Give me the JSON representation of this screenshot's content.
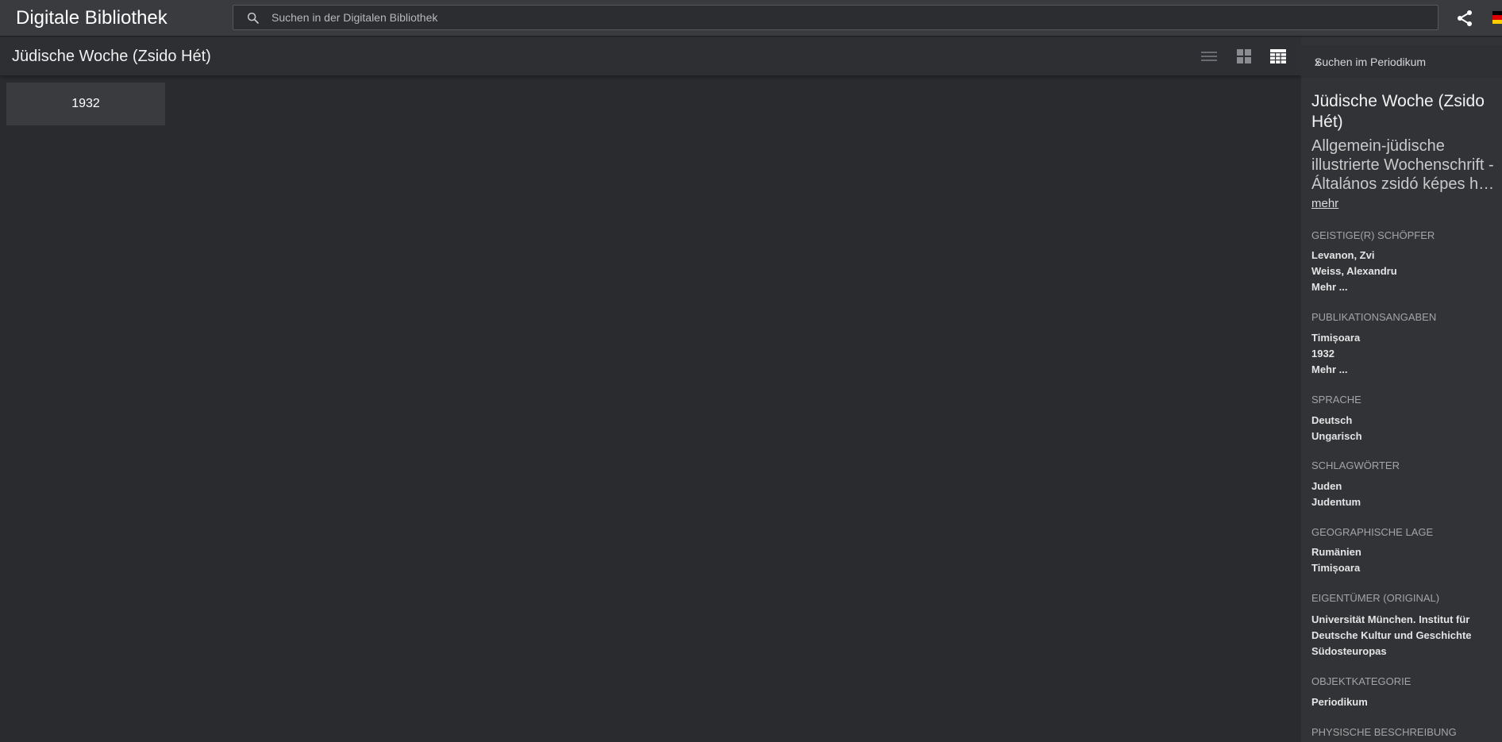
{
  "topbar": {
    "brand": "Digitale Bibliothek",
    "search_placeholder": "Suchen in der Digitalen Bibliothek"
  },
  "main": {
    "title": "Jüdische Woche (Zsido Hét)",
    "years": [
      "1932"
    ]
  },
  "sidebar": {
    "search_label": "Suchen im Periodikum",
    "close_icon": "x",
    "title": "Jüdische Woche (Zsido Hét)",
    "subtitle_lines": [
      "Allgemein-jüdische",
      "illustrierte Wochenschrift -",
      "Általános zsidó képes he..."
    ],
    "more_label": "mehr",
    "sections": [
      {
        "heading": "GEISTIGE(R) SCHÖPFER",
        "values": [
          "Levanon, Zvi",
          "Weiss, Alexandru"
        ],
        "more": "Mehr ..."
      },
      {
        "heading": "PUBLIKATIONSANGABEN",
        "values": [
          "Timișoara",
          "1932"
        ],
        "more": "Mehr ..."
      },
      {
        "heading": "SPRACHE",
        "values": [
          "Deutsch",
          "Ungarisch"
        ]
      },
      {
        "heading": "SCHLAGWÖRTER",
        "values": [
          "Juden",
          "Judentum"
        ]
      },
      {
        "heading": "GEOGRAPHISCHE LAGE",
        "values": [
          "Rumänien",
          "Timișoara"
        ]
      },
      {
        "heading": "EIGENTÜMER (ORIGINAL)",
        "values": [
          "Universität München. Institut für",
          "Deutsche Kultur und Geschichte",
          "Südosteuropas"
        ]
      },
      {
        "heading": "OBJEKTKATEGORIE",
        "values": [
          "Periodikum"
        ]
      },
      {
        "heading": "PHYSISCHE BESCHREIBUNG",
        "values": []
      }
    ]
  },
  "colors": {
    "background": "#2a2b2f",
    "topbar": "#3a3b3f",
    "sidebar": "#323337",
    "flag": [
      "#000000",
      "#dd0000",
      "#ffcc00"
    ]
  },
  "icons": [
    "search-icon",
    "share-icon",
    "list-view-icon",
    "grid-view-icon",
    "table-view-icon",
    "close-icon",
    "flag-de-icon"
  ]
}
